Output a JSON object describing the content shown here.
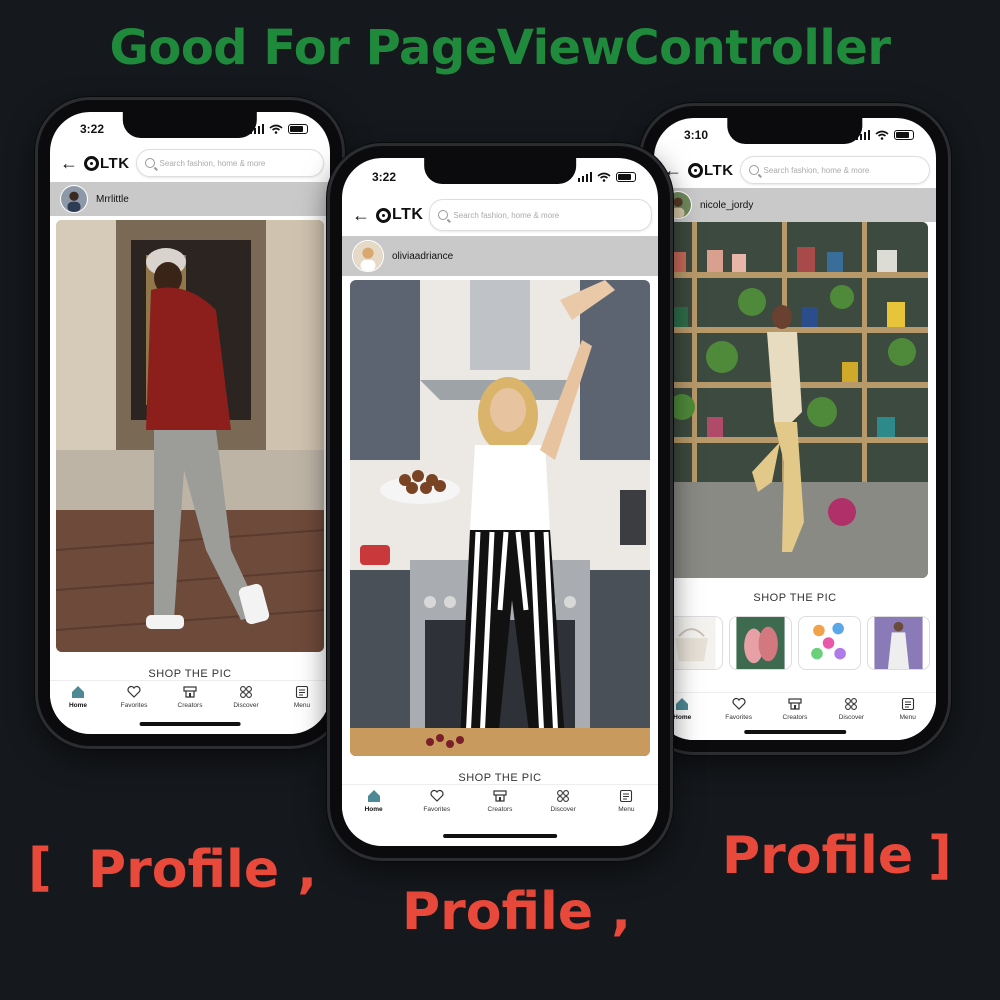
{
  "headline": "Good For PageViewController",
  "captions": {
    "left_bracket": "[",
    "left": "Profile ,",
    "middle": "Profile ,",
    "right": "Profile",
    "right_bracket": "]"
  },
  "app": {
    "brand": "LTK",
    "search_placeholder": "Search fashion, home & more",
    "shop_label": "SHOP THE PIC",
    "tabs": [
      "Home",
      "Favorites",
      "Creators",
      "Discover",
      "Menu"
    ],
    "accent": "#4d8a96"
  },
  "phones": {
    "left": {
      "time": "3:22",
      "creator": "Mrrlittle"
    },
    "center": {
      "time": "3:22",
      "creator": "oliviaadriance"
    },
    "right": {
      "time": "3:10",
      "creator": "nicole_jordy"
    }
  },
  "colors": {
    "headline": "#1f8a3b",
    "caption": "#e8493a",
    "background": "#15181c"
  }
}
